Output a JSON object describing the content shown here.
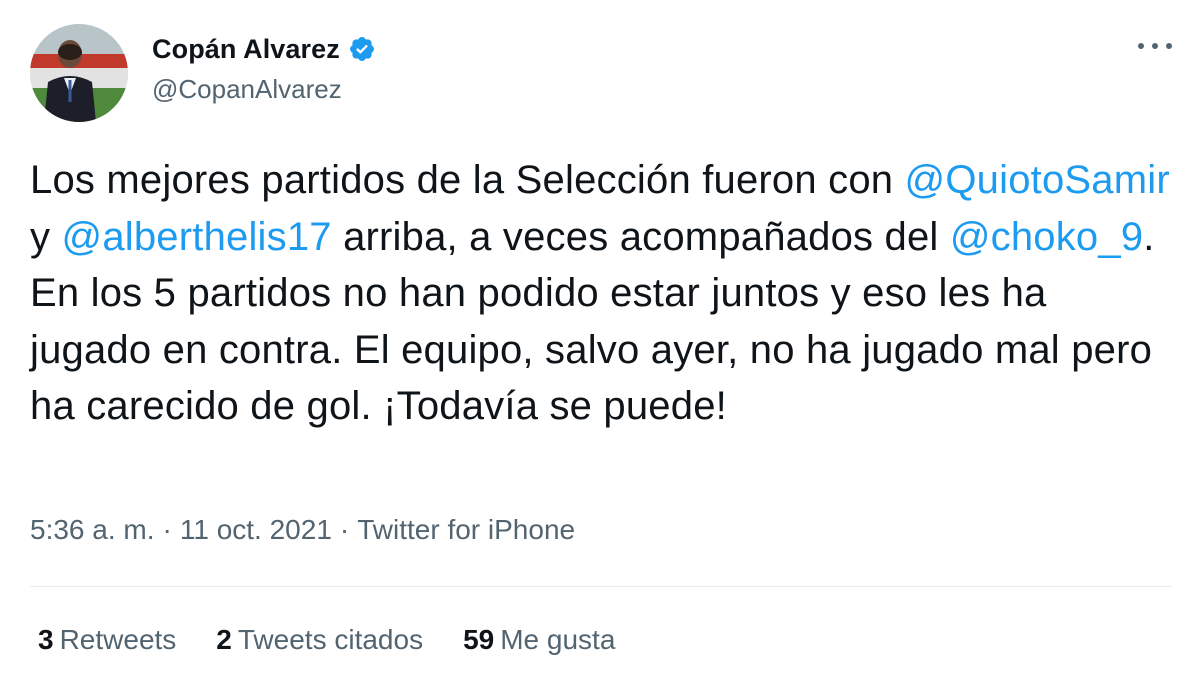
{
  "author": {
    "display_name": "Copán Alvarez",
    "handle": "@CopanAlvarez",
    "verified": true,
    "verified_icon": "verified-badge-icon",
    "avatar_icon": "profile-avatar"
  },
  "menu": {
    "icon": "more-dots-icon"
  },
  "tweet": {
    "segments": [
      {
        "type": "text",
        "value": "Los mejores partidos de la Selección fueron con "
      },
      {
        "type": "mention",
        "value": "@QuiotoSamir"
      },
      {
        "type": "text",
        "value": " y "
      },
      {
        "type": "mention",
        "value": "@alberthelis17"
      },
      {
        "type": "text",
        "value": " arriba, a veces acompañados del "
      },
      {
        "type": "mention",
        "value": "@choko_9"
      },
      {
        "type": "text",
        "value": ". En los 5 partidos no han podido estar juntos y eso les ha jugado en contra. El equipo, salvo ayer, no ha jugado mal pero ha carecido de gol. ¡Todavía se puede!"
      }
    ]
  },
  "meta": {
    "time": "5:36 a. m.",
    "separator": "·",
    "date": "11 oct. 2021",
    "source": "Twitter for iPhone"
  },
  "stats": {
    "retweets_count": "3",
    "retweets_label": "Retweets",
    "quotes_count": "2",
    "quotes_label": "Tweets citados",
    "likes_count": "59",
    "likes_label": "Me gusta"
  },
  "colors": {
    "accent": "#1d9bf0",
    "text": "#0f1419",
    "secondary": "#536471",
    "divider": "#e6ecf0"
  }
}
